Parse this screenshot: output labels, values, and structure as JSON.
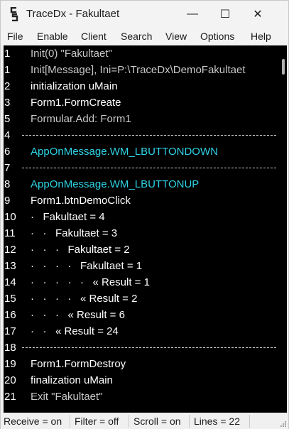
{
  "window": {
    "title": "TraceDx - Fakultaet",
    "controls": {
      "minimize": "—",
      "maximize": "☐",
      "close": "✕"
    }
  },
  "menu": [
    "File",
    "Enable",
    "Client",
    "Search",
    "View",
    "Options",
    "Help"
  ],
  "colors": {
    "log_background": "#000000",
    "text_default": "#ffffff",
    "text_grey": "#c8c8c8",
    "text_cyan": "#2fd3e6"
  },
  "log_lines": [
    {
      "num": "1",
      "text": "Init(0) \"Fakultaet\"",
      "color": "grey"
    },
    {
      "num": "1",
      "text": "Init[Message], Ini=P:\\TraceDx\\DemoFakultaet",
      "color": "grey"
    },
    {
      "num": "2",
      "text": "initialization uMain",
      "color": "white"
    },
    {
      "num": "3",
      "text": "Form1.FormCreate",
      "color": "white"
    },
    {
      "num": "5",
      "text": "Formular.Add: Form1",
      "color": "grey"
    },
    {
      "num": "4",
      "text": "",
      "color": "separator"
    },
    {
      "num": "6",
      "text": "AppOnMessage.WM_LBUTTONDOWN",
      "color": "cyan"
    },
    {
      "num": "7",
      "text": "",
      "color": "separator"
    },
    {
      "num": "8",
      "text": "AppOnMessage.WM_LBUTTONUP",
      "color": "cyan"
    },
    {
      "num": "9",
      "text": "Form1.btnDemoClick",
      "color": "white"
    },
    {
      "num": "10",
      "text": "·   Fakultaet = 4",
      "color": "white"
    },
    {
      "num": "11",
      "text": "·   ·   Fakultaet = 3",
      "color": "white"
    },
    {
      "num": "12",
      "text": "·   ·   ·   Fakultaet = 2",
      "color": "white"
    },
    {
      "num": "13",
      "text": "·   ·   ·   ·   Fakultaet = 1",
      "color": "white"
    },
    {
      "num": "14",
      "text": "·   ·   ·   ·   ·   « Result = 1",
      "color": "white"
    },
    {
      "num": "15",
      "text": "·   ·   ·   ·   « Result = 2",
      "color": "white"
    },
    {
      "num": "16",
      "text": "·   ·   ·   « Result = 6",
      "color": "white"
    },
    {
      "num": "17",
      "text": "·   ·   « Result = 24",
      "color": "white"
    },
    {
      "num": "18",
      "text": "",
      "color": "separator"
    },
    {
      "num": "19",
      "text": "Form1.FormDestroy",
      "color": "white"
    },
    {
      "num": "20",
      "text": "finalization uMain",
      "color": "white"
    },
    {
      "num": "21",
      "text": "Exit \"Fakultaet\"",
      "color": "grey"
    }
  ],
  "status": {
    "receive": "Receive = on",
    "filter": "Filter = off",
    "scroll": "Scroll = on",
    "lines": "Lines = 22"
  }
}
